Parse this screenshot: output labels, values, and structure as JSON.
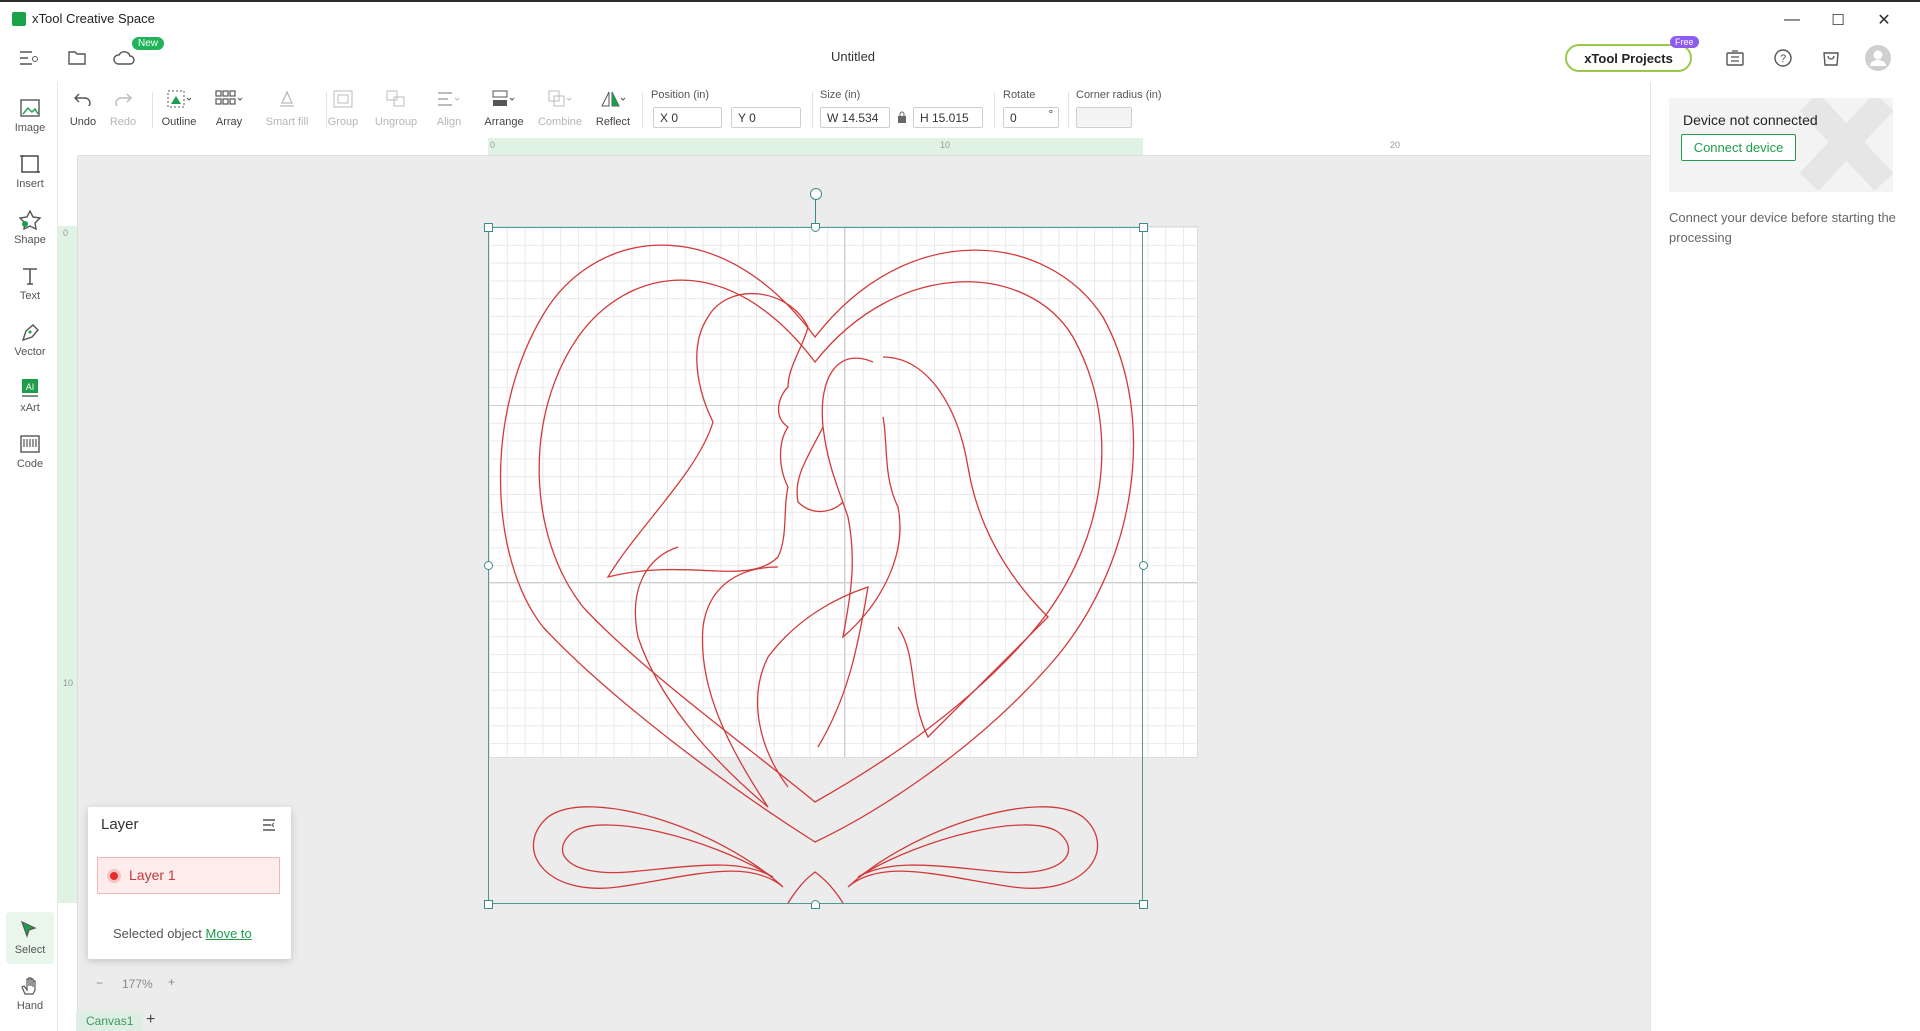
{
  "window": {
    "app_title": "xTool Creative Space",
    "minimize": "—",
    "maximize": "☐",
    "close": "✕"
  },
  "appbar": {
    "doc_title": "Untitled",
    "new_badge": "New",
    "projects_label": "xTool Projects",
    "free_badge": "Free"
  },
  "left_tools": [
    {
      "label": "Image"
    },
    {
      "label": "Insert"
    },
    {
      "label": "Shape"
    },
    {
      "label": "Text"
    },
    {
      "label": "Vector"
    },
    {
      "label": "xArt"
    },
    {
      "label": "Code"
    },
    {
      "label": "Select"
    },
    {
      "label": "Hand"
    }
  ],
  "toolbar": {
    "undo": "Undo",
    "redo": "Redo",
    "outline": "Outline",
    "array": "Array",
    "smart_fill": "Smart fill",
    "group": "Group",
    "ungroup": "Ungroup",
    "align": "Align",
    "arrange": "Arrange",
    "combine": "Combine",
    "reflect": "Reflect",
    "position_label": "Position (in)",
    "pos_x": "X 0",
    "pos_y": "Y 0",
    "size_label": "Size (in)",
    "width": "W 14.534",
    "height": "H 15.015",
    "rotate_label": "Rotate",
    "rotate_value": "0",
    "rotate_unit": "°",
    "corner_label": "Corner radius (in)",
    "corner_value": ""
  },
  "ruler": {
    "top": [
      "0",
      "10",
      "20"
    ],
    "left": [
      "0",
      "10"
    ]
  },
  "right_panel": {
    "device_title": "Device not connected",
    "connect_label": "Connect device",
    "note": "Connect your device before starting the processing"
  },
  "layer_panel": {
    "title": "Layer",
    "layer_name": "Layer 1",
    "selected_text": "Selected object",
    "move_to": "Move to"
  },
  "zoom": {
    "minus": "−",
    "value": "177%",
    "plus": "+"
  },
  "canvas_tabs": {
    "tab": "Canvas1",
    "add": "+"
  },
  "colors": {
    "accent": "#1e9e4a",
    "cut_line": "#d23a3a",
    "selection": "#4d9a99"
  }
}
